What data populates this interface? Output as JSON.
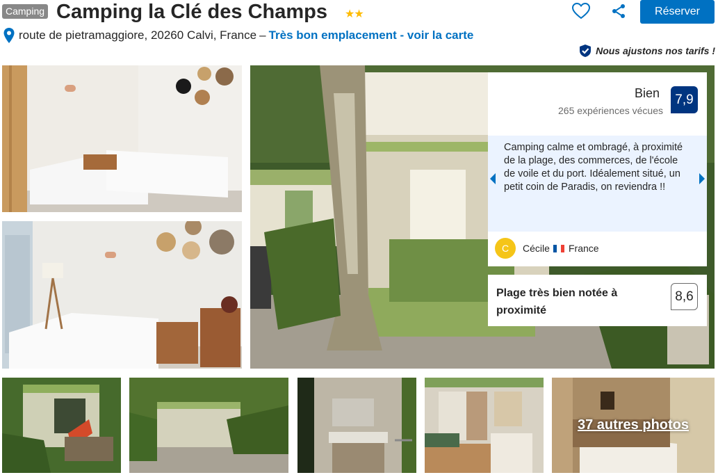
{
  "header": {
    "category_badge": "Camping",
    "title": "Camping la Clé des Champs",
    "stars": "★★",
    "reserve_label": "Réserver"
  },
  "address": {
    "text": "route de pietramaggiore, 20260 Calvi, France",
    "separator": "–",
    "location_link": "Très bon emplacement - voir la carte"
  },
  "price_note": "Nous ajustons nos tarifs !",
  "review": {
    "rating_word": "Bien",
    "rating_count": "265 expériences vécues",
    "score": "7,9",
    "quote": "Camping calme et ombragé, à proximité de la plage, des commerces, de l'école de voile et du port. Idéalement situé, un petit coin de Paradis, on reviendra !!",
    "reviewer_initial": "C",
    "reviewer_name": "Cécile",
    "reviewer_country": "France"
  },
  "beach": {
    "label": "Plage très bien notée à proximité",
    "score": "8,6"
  },
  "more_photos_label": "37 autres photos",
  "colors": {
    "brand_blue": "#0071c2",
    "score_navy": "#003580",
    "star_yellow": "#febb02",
    "quote_bg": "#ebf3ff"
  }
}
